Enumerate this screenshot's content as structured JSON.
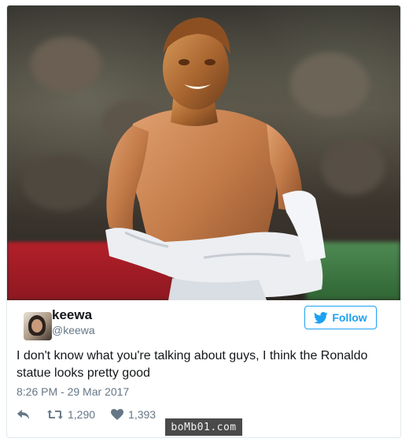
{
  "tweet": {
    "user": {
      "name": "keewa",
      "handle": "@keewa"
    },
    "follow_label": "Follow",
    "text": "I don't know what you're talking about guys, I think the Ronaldo statue looks pretty good",
    "timestamp": "8:26 PM - 29 Mar 2017",
    "stats": {
      "retweets": "1,290",
      "likes": "1,393"
    }
  },
  "watermark": "boMb01.com",
  "icons": {
    "follow": "twitter-bird-icon",
    "reply": "reply-icon",
    "retweet": "retweet-icon",
    "like": "heart-icon"
  },
  "colors": {
    "accent": "#1da1f2",
    "text": "#14171a",
    "muted": "#657786",
    "border": "#e1e8ed"
  }
}
